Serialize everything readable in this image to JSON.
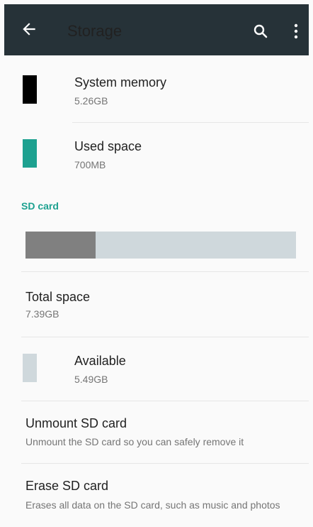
{
  "toolbar": {
    "title": "Storage",
    "back_icon": "arrow-left-icon",
    "search_icon": "search-icon",
    "more_icon": "more-vert-icon"
  },
  "items": {
    "system_memory": {
      "title": "System memory",
      "value": "5.26GB",
      "color": "#000000"
    },
    "used_space": {
      "title": "Used space",
      "value": "700MB",
      "color": "#1da190"
    }
  },
  "sd_card": {
    "header": "SD card",
    "usage_fraction": 0.26,
    "bar_fill_color": "#808080",
    "bar_track_color": "#cfd8dc"
  },
  "total_space": {
    "title": "Total space",
    "value": "7.39GB"
  },
  "available": {
    "title": "Available",
    "value": "5.49GB",
    "color": "#cfd8dc"
  },
  "unmount": {
    "title": "Unmount SD card",
    "summary": "Unmount the SD card so you can safely remove it"
  },
  "erase": {
    "title": "Erase SD card",
    "summary": "Erases all data on the SD card, such as music and photos"
  }
}
